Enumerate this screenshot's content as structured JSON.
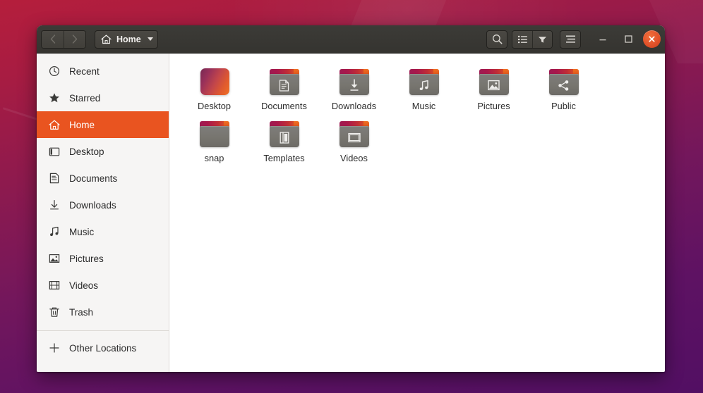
{
  "desktop": {
    "wallpaper_top_color": "#b51e3c",
    "wallpaper_bottom_color": "#520f63"
  },
  "window": {
    "accent_color": "#e95420",
    "headerbar_color": "#3c3b37",
    "sidebar_color": "#f6f5f4",
    "titlebar": {
      "back_label": "‹",
      "forward_label": "›",
      "path_label": "Home",
      "path_home_icon": "home-icon",
      "path_caret_icon": "chevron-down-icon",
      "search_icon": "search-icon",
      "list_view_icon": "list-view-icon",
      "view_options_icon": "view-options-caret-icon",
      "menu_icon": "hamburger-menu-icon",
      "minimize_label": "–",
      "maximize_label": "□",
      "close_label": "×"
    }
  },
  "sidebar": {
    "items": [
      {
        "label": "Recent",
        "icon": "clock-icon",
        "active": false
      },
      {
        "label": "Starred",
        "icon": "star-icon",
        "active": false
      },
      {
        "label": "Home",
        "icon": "home-icon",
        "active": true
      },
      {
        "label": "Desktop",
        "icon": "desktop-icon",
        "active": false
      },
      {
        "label": "Documents",
        "icon": "document-icon",
        "active": false
      },
      {
        "label": "Downloads",
        "icon": "download-icon",
        "active": false
      },
      {
        "label": "Music",
        "icon": "music-icon",
        "active": false
      },
      {
        "label": "Pictures",
        "icon": "picture-icon",
        "active": false
      },
      {
        "label": "Videos",
        "icon": "video-icon",
        "active": false
      },
      {
        "label": "Trash",
        "icon": "trash-icon",
        "active": false
      }
    ],
    "other_locations": {
      "label": "Other Locations",
      "icon": "plus-icon"
    }
  },
  "files": [
    {
      "name": "Desktop",
      "kind": "desktop-gradient",
      "emblem": "none"
    },
    {
      "name": "Documents",
      "kind": "folder",
      "emblem": "document-icon"
    },
    {
      "name": "Downloads",
      "kind": "folder",
      "emblem": "download-icon"
    },
    {
      "name": "Music",
      "kind": "folder",
      "emblem": "music-icon"
    },
    {
      "name": "Pictures",
      "kind": "folder",
      "emblem": "picture-icon"
    },
    {
      "name": "Public",
      "kind": "folder",
      "emblem": "share-icon"
    },
    {
      "name": "snap",
      "kind": "folder",
      "emblem": "none"
    },
    {
      "name": "Templates",
      "kind": "folder",
      "emblem": "template-icon"
    },
    {
      "name": "Videos",
      "kind": "folder",
      "emblem": "video-icon"
    }
  ]
}
